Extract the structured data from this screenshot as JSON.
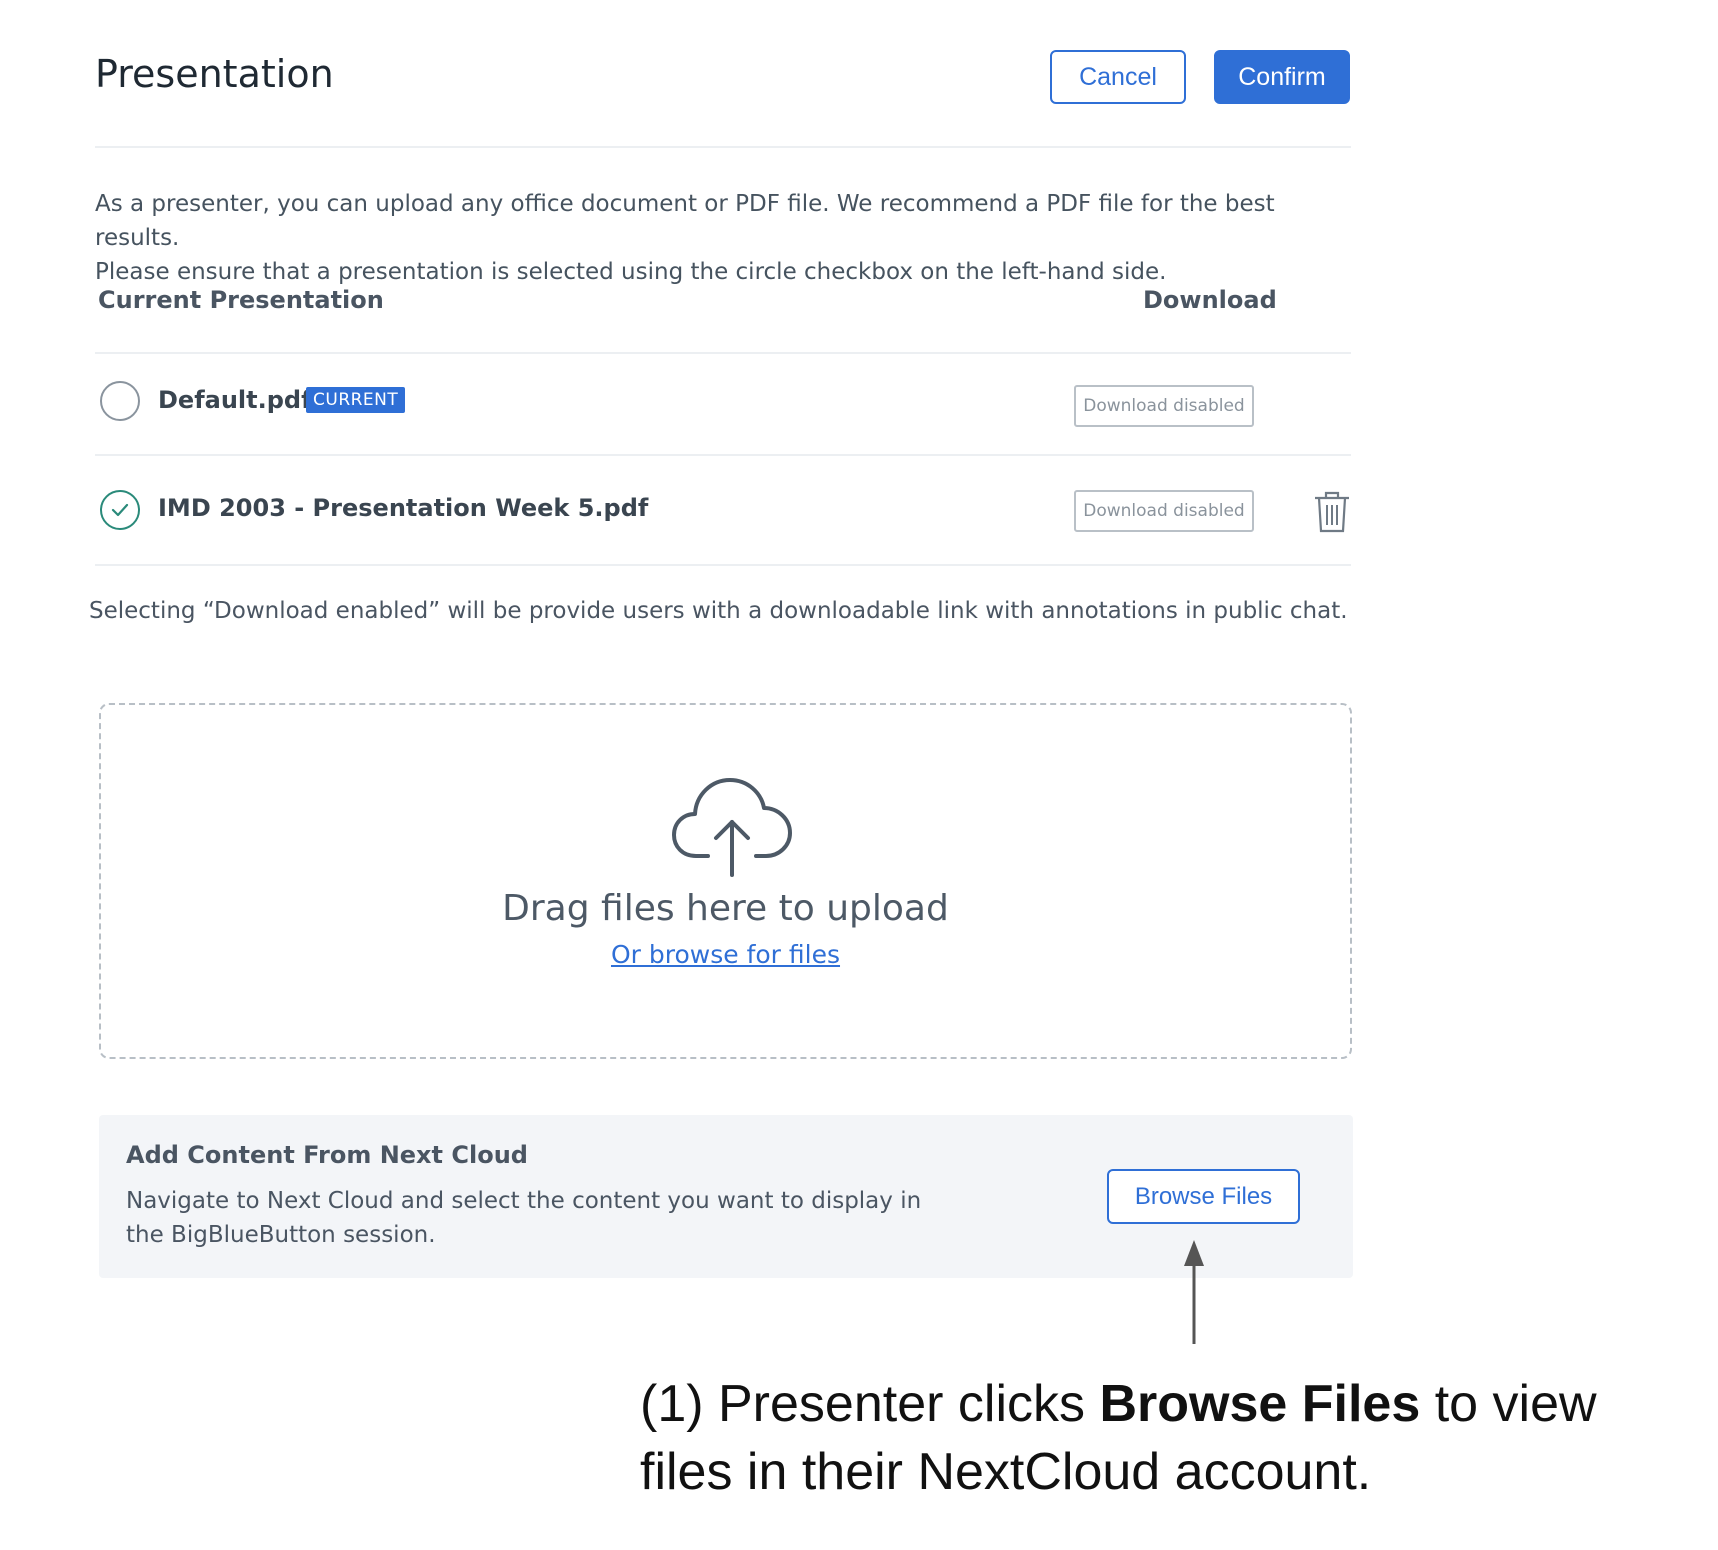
{
  "header": {
    "title": "Presentation",
    "cancel_label": "Cancel",
    "confirm_label": "Confirm"
  },
  "description": {
    "line1": "As a presenter, you can upload any office document or PDF file. We recommend a PDF file for the best results.",
    "line2": "Please ensure that a presentation is selected using the circle checkbox on the left-hand side."
  },
  "table": {
    "col_current": "Current Presentation",
    "col_download": "Download",
    "rows": [
      {
        "name": "Default.pdf",
        "badge": "CURRENT",
        "selected": false,
        "download": "Download disabled",
        "deletable": false
      },
      {
        "name": "IMD 2003 - Presentation Week 5.pdf",
        "badge": "",
        "selected": true,
        "download": "Download disabled",
        "deletable": true
      }
    ]
  },
  "note": "Selecting “Download enabled” will be provide users with a downloadable link with annotations in public chat.",
  "dropzone": {
    "drag_text": "Drag files here to upload",
    "browse_link": "Or browse for files"
  },
  "nextcloud": {
    "title": "Add Content From Next Cloud",
    "desc_line1": "Navigate to Next Cloud and select the content you want to display in",
    "desc_line2": "the BigBlueButton session.",
    "button_label": "Browse Files"
  },
  "annotation": {
    "prefix": "(1) Presenter clicks ",
    "bold": "Browse Files",
    "suffix": " to view files in their NextCloud account."
  },
  "colors": {
    "accent": "#2f6fd6",
    "check": "#2a8a7a"
  }
}
